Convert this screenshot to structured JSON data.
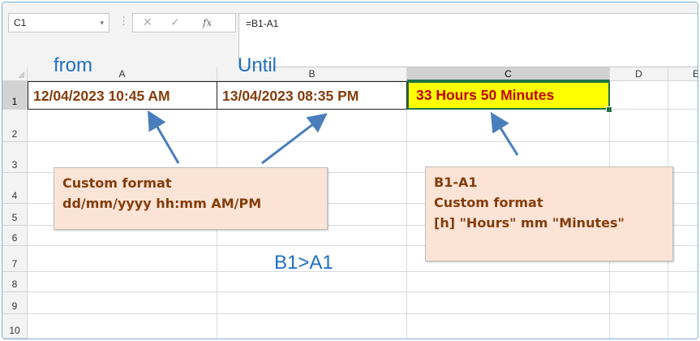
{
  "formula_bar": {
    "name_box": "C1",
    "name_box_dropdown": "▾",
    "separator": "⋮",
    "cancel_icon": "✕",
    "enter_icon": "✓",
    "fx_icon": "fx",
    "formula": "=B1-A1"
  },
  "columns": [
    "A",
    "B",
    "C",
    "D",
    "E"
  ],
  "rows": [
    "1",
    "2",
    "3",
    "4",
    "5",
    "6",
    "7",
    "8",
    "9",
    "10"
  ],
  "cells": {
    "A1": "12/04/2023 10:45 AM",
    "B1": "13/04/2023 08:35 PM",
    "C1": "33 Hours  50 Minutes"
  },
  "annotations": {
    "from": "from",
    "until": "Until",
    "condition": "B1>A1"
  },
  "callout_left": {
    "line1": "Custom format",
    "line2": "dd/mm/yyyy hh:mm AM/PM"
  },
  "callout_right": {
    "line1": "B1-A1",
    "line2": "Custom format",
    "line3": "[h] \"Hours\" mm \"Minutes\""
  },
  "colors": {
    "accent": "#217346",
    "annotation_blue": "#1f6fc0",
    "cell_text": "#843c0c",
    "result_text": "#c00000",
    "result_fill": "#ffff00",
    "callout_fill": "#fbe4d5",
    "arrow": "#4a7ebb"
  }
}
